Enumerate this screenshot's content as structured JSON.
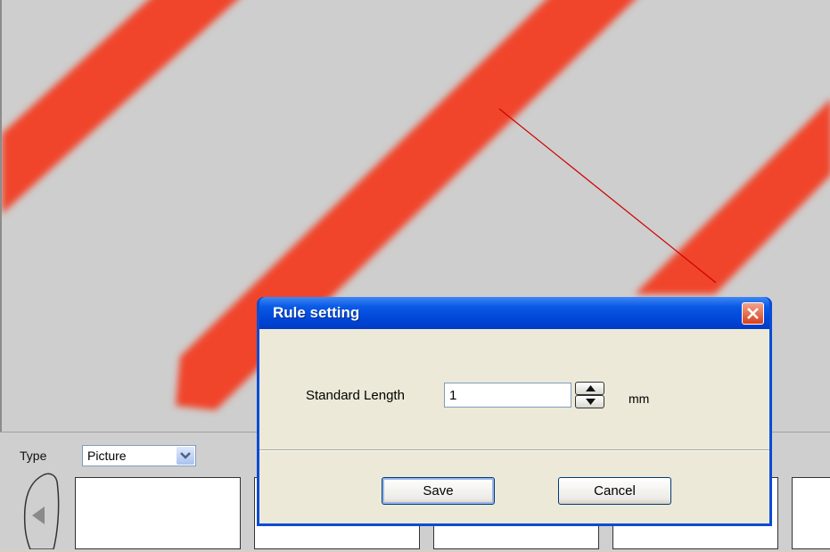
{
  "dialog": {
    "title": "Rule setting",
    "field_label": "Standard Length",
    "length_value": "1",
    "unit": "mm",
    "save_label": "Save",
    "cancel_label": "Cancel"
  },
  "toolbar": {
    "type_label": "Type",
    "type_value": "Picture"
  },
  "icons": {
    "close": "close-icon",
    "dropdown": "chevron-down-icon",
    "spin_up": "arrow-up-icon",
    "spin_down": "arrow-down-icon",
    "prev": "arrow-left-icon"
  },
  "colors": {
    "stripe": "#f0442a",
    "background": "#c9c9c9",
    "measure_line": "#cc0000",
    "title_bar": "#0a5ae5"
  }
}
